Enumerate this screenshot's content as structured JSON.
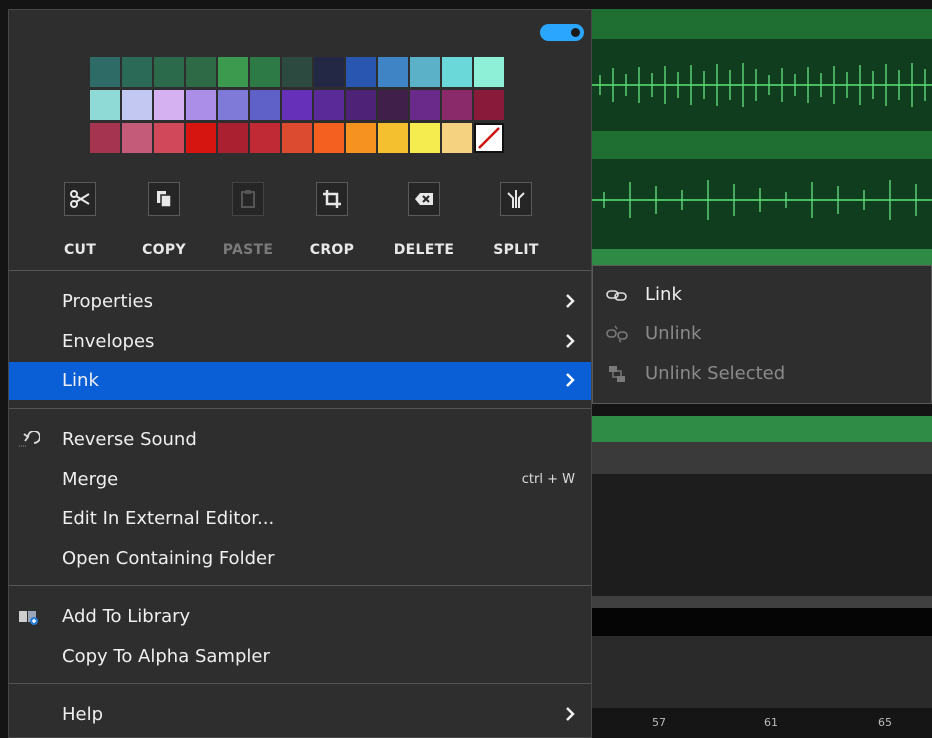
{
  "toggle": {
    "on": true,
    "color": "#2aa6ff"
  },
  "palette": [
    [
      "#2e6b67",
      "#2b6a56",
      "#2c6a4c",
      "#2e6a45",
      "#3c9a4f",
      "#2e7a46",
      "#2c4a3f",
      "#232845",
      "#2956b1",
      "#3f84c4",
      "#5ab1c8",
      "#6ad8d8",
      "#8ff0d8"
    ],
    [
      "#8fd9d6",
      "#c3c8f2",
      "#d6b1f2",
      "#aa8ee8",
      "#7f79d8",
      "#5f60c8",
      "#6630b8",
      "#5a2a98",
      "#4e2276",
      "#40204a",
      "#6a2a8a",
      "#8a2a6a",
      "#8a1a3a"
    ],
    [
      "#a43450",
      "#c45b78",
      "#d0485a",
      "#d61410",
      "#aa2030",
      "#c02a35",
      "#dc4a30",
      "#f46020",
      "#f59220",
      "#f5c030",
      "#f5ec50",
      "#f4d280",
      "none"
    ]
  ],
  "tools": [
    {
      "label": "CUT",
      "icon": "scissors-icon",
      "enabled": true
    },
    {
      "label": "COPY",
      "icon": "copy-icon",
      "enabled": true
    },
    {
      "label": "PASTE",
      "icon": "paste-icon",
      "enabled": false
    },
    {
      "label": "CROP",
      "icon": "crop-icon",
      "enabled": true
    },
    {
      "label": "DELETE",
      "icon": "backspace-icon",
      "enabled": true
    },
    {
      "label": "SPLIT",
      "icon": "split-icon",
      "enabled": true
    }
  ],
  "menu": {
    "properties": "Properties",
    "envelopes": "Envelopes",
    "link": "Link",
    "reverse_sound": "Reverse Sound",
    "merge": "Merge",
    "merge_shortcut": "ctrl + W",
    "edit_external": "Edit In External Editor...",
    "open_folder": "Open Containing Folder",
    "add_library": "Add To Library",
    "copy_alpha": "Copy To Alpha Sampler",
    "help": "Help"
  },
  "submenu": {
    "link": "Link",
    "unlink": "Unlink",
    "unlink_selected": "Unlink Selected"
  },
  "background": {
    "ticks": [
      "57",
      "61",
      "65"
    ]
  }
}
